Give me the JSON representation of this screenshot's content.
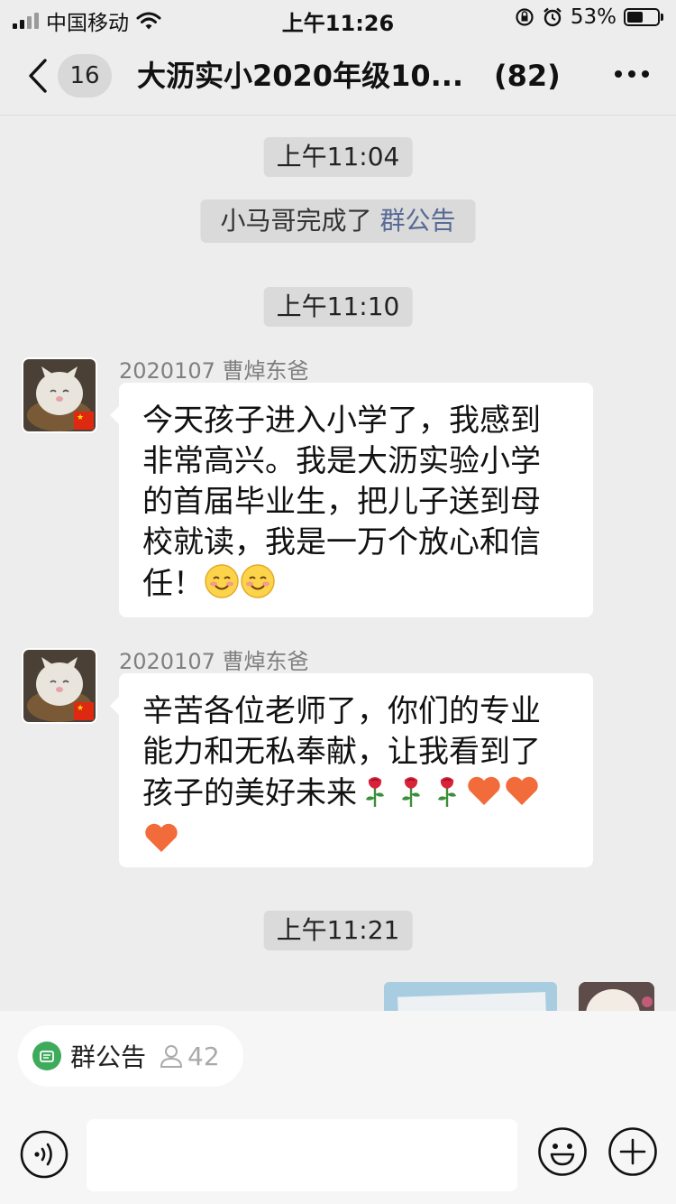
{
  "status_bar": {
    "carrier": "中国移动",
    "time": "上午11:26",
    "battery": "53%",
    "battery_level": 0.53,
    "icons": [
      "signal-icon",
      "wifi-icon",
      "rotation-lock-icon",
      "alarm-icon",
      "battery-icon"
    ]
  },
  "nav": {
    "unread_count": "16",
    "title": "大沥实小2020年级10...",
    "member_count": "(82)",
    "icons": [
      "back-chevron-icon",
      "more-dots-icon"
    ]
  },
  "chat": {
    "timestamps": [
      "上午11:04",
      "上午11:10",
      "上午11:21"
    ],
    "system_message": {
      "text": "小马哥完成了",
      "link": "群公告"
    },
    "messages": [
      {
        "sender": "2020107 曹焯东爸",
        "text": "今天孩子进入小学了，我感到非常高兴。我是大沥实验小学的首届毕业生，把儿子送到母校就读，我是一万个放心和信任！",
        "emoji": [
          "smiling-face-icon",
          "smiling-face-icon"
        ]
      },
      {
        "sender": "2020107 曹焯东爸",
        "text": "辛苦各位老师了，你们的专业能力和无私奉献，让我看到了孩子的美好未来",
        "emoji": [
          "rose-icon",
          "rose-icon",
          "rose-icon",
          "heart-icon",
          "heart-icon",
          "heart-icon"
        ]
      }
    ]
  },
  "notice_bar": {
    "label": "群公告",
    "count": "42",
    "icons": [
      "notice-icon",
      "person-icon"
    ]
  },
  "input_bar": {
    "placeholder": "",
    "icons": [
      "voice-icon",
      "emoji-icon",
      "plus-icon"
    ]
  },
  "colors": {
    "background": "#ededed",
    "link": "#576b95",
    "notice_green": "#3eaa5b",
    "heart": "#f26b3a",
    "rose": "#d9233a"
  }
}
